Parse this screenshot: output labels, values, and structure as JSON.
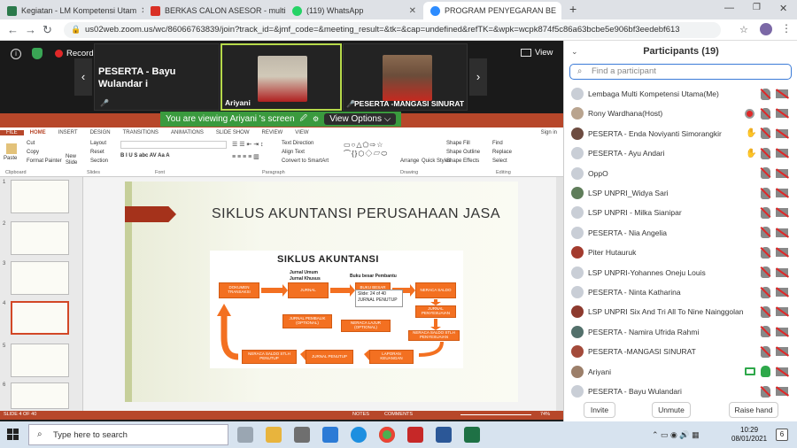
{
  "browser": {
    "tabs": [
      {
        "label": "Kegiatan - LM Kompetensi Utam",
        "color": "#2b7a4b"
      },
      {
        "label": "BERKAS CALON ASESOR - multik",
        "color": "#d93025"
      },
      {
        "label": "(119) WhatsApp",
        "color": "#25d366"
      },
      {
        "label": "PROGRAM PENYEGARAN BE",
        "color": "#2d8cff"
      }
    ],
    "url": "us02web.zoom.us/wc/86066763839/join?track_id=&jmf_code=&meeting_result=&tk=&cap=undefined&refTK=&wpk=wcpk874f5c86a63bcbe5e906bf3eedebf613"
  },
  "meeting": {
    "recording": "Recording",
    "view": "View",
    "speaker_label": "PESERTA - Bayu Wulandar i",
    "video1_name": "Ariyani",
    "video2_name": "PESERTA -MANGASI SINURAT",
    "banner_text": "You are viewing Ariyani 's screen",
    "view_options": "View Options"
  },
  "ppt": {
    "tabs": [
      "FILE",
      "HOME",
      "INSERT",
      "DESIGN",
      "TRANSITIONS",
      "ANIMATIONS",
      "SLIDE SHOW",
      "REVIEW",
      "VIEW"
    ],
    "signin": "Sign in",
    "groups": [
      "Clipboard",
      "Slides",
      "Font",
      "Paragraph",
      "Drawing",
      "Editing"
    ],
    "buttons": [
      "Paste",
      "Cut",
      "Copy",
      "Format Painter",
      "New Slide",
      "Layout",
      "Reset",
      "Section",
      "Text Direction",
      "Align Text",
      "Convert to SmartArt",
      "Arrange",
      "Quick Styles",
      "Shape Fill",
      "Shape Outline",
      "Shape Effects",
      "Find",
      "Replace",
      "Select"
    ],
    "slide_title": "SIKLUS AKUNTANSI PERUSAHAAN JASA",
    "diagram": {
      "title": "SIKLUS AKUNTANSI",
      "small1": "Jurnal Umum",
      "small2": "Jurnal Khusus",
      "small3": "Buku besar Pembantu",
      "boxes": [
        "DOKUMEN TRANSAKSI",
        "JURNAL",
        "BUKU BESAR",
        "NERACA SALDO",
        "JURNAL PENYESUAIAN",
        "NERACA SALDO STLH PENYESUAIAN",
        "NERACA LAJUR (OPTIONAL)",
        "JURNAL PEMBALIK (OPTIONAL)",
        "LAPORAN KEUANGAN",
        "JURNAL PENUTUP",
        "NERACA SALDO STLH PENUTUP"
      ],
      "tooltip": [
        "Slide: 24 of 40",
        "JURNAL PENUTUP"
      ]
    },
    "status_left": "SLIDE 4 OF 40",
    "notes": "NOTES",
    "comments": "COMMENTS",
    "zoom": "74%"
  },
  "participants": {
    "title": "Participants (19)",
    "search_placeholder": "Find a participant",
    "list": [
      {
        "name": "Lembaga Multi Kompetensi Utama(Me)"
      },
      {
        "name": "Rony Wardhana(Host)"
      },
      {
        "name": "PESERTA - Enda Noviyanti Simorangkir"
      },
      {
        "name": "PESERTA - Ayu Andari"
      },
      {
        "name": "OppO"
      },
      {
        "name": "LSP UNPRI_Widya Sari"
      },
      {
        "name": "LSP UNPRI - Milka Sianipar"
      },
      {
        "name": "PESERTA - Nia Angelia"
      },
      {
        "name": "Piter Hutauruk"
      },
      {
        "name": "LSP UNPRI-Yohannes Oneju Louis"
      },
      {
        "name": "PESERTA - Ninta Katharina"
      },
      {
        "name": "LSP UNPRI Six And Tri All To Nine Nainggolan"
      },
      {
        "name": "PESERTA - Namira Ufrida Rahmi"
      },
      {
        "name": "PESERTA -MANGASI SINURAT"
      },
      {
        "name": "Ariyani"
      },
      {
        "name": "PESERTA - Bayu Wulandari"
      }
    ],
    "buttons": {
      "invite": "Invite",
      "unmute": "Unmute",
      "raise": "Raise hand"
    }
  },
  "taskbar": {
    "search_placeholder": "Type here to search",
    "time": "10:29",
    "date": "08/01/2021",
    "notif_count": "6"
  },
  "colors": {
    "ppt_red": "#b7472a",
    "zoom_blue": "#2d8cff",
    "orange": "#f37021",
    "muted_red": "#e02828"
  }
}
